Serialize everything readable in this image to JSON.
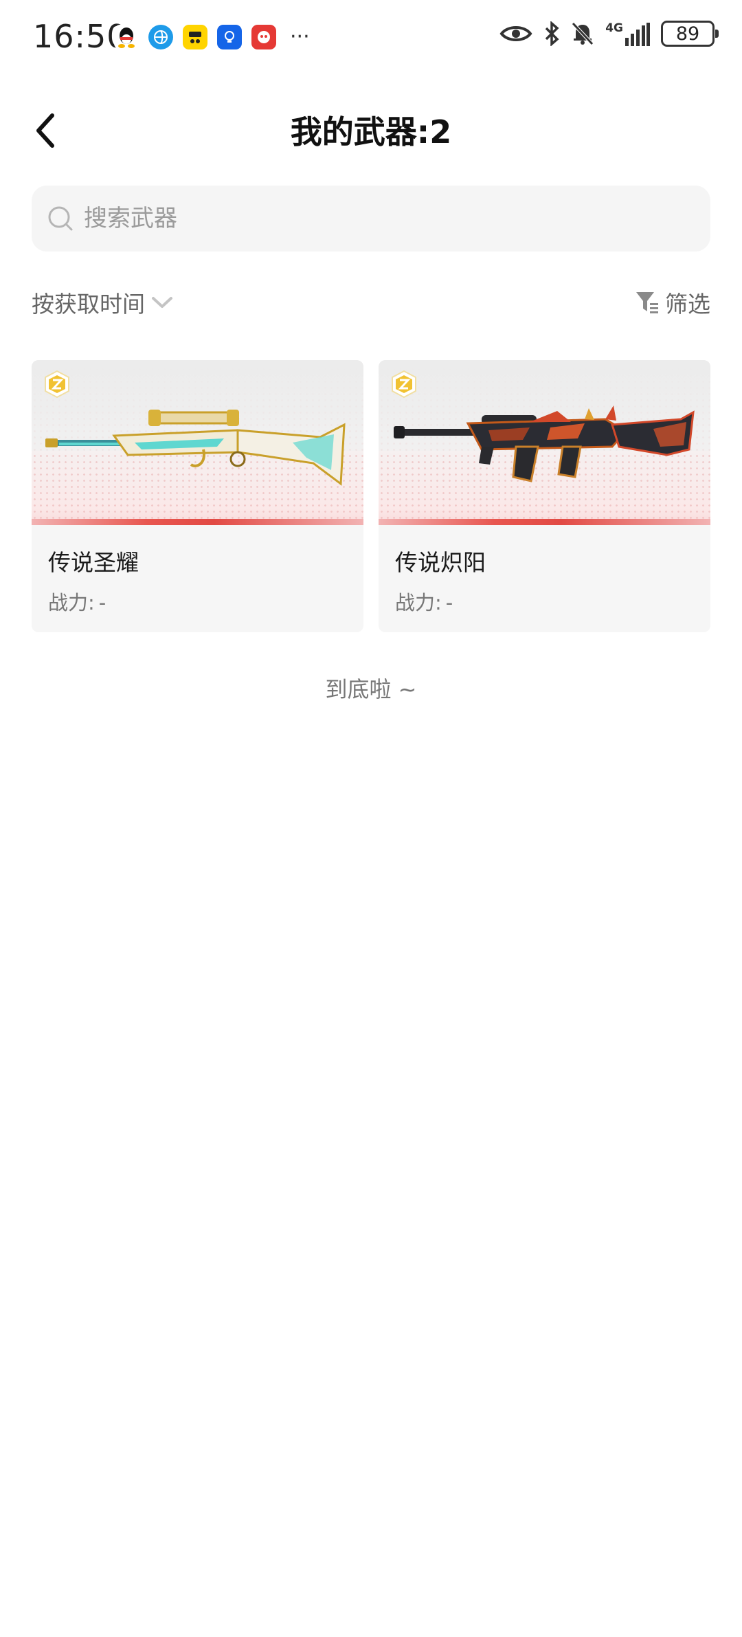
{
  "status_bar": {
    "time": "16:50",
    "more": "···",
    "network": "4G",
    "battery": "89"
  },
  "header": {
    "title": "我的武器:2"
  },
  "search": {
    "placeholder": "搜索武器"
  },
  "sort": {
    "label": "按获取时间"
  },
  "filter": {
    "label": "筛选"
  },
  "weapons": [
    {
      "name": "传说圣耀",
      "power_label": "战力:",
      "power_value": "-"
    },
    {
      "name": "传说炽阳",
      "power_label": "战力:",
      "power_value": "-"
    }
  ],
  "footer": {
    "end_text": "到底啦 ~"
  },
  "colors": {
    "accent_red": "#e24a44",
    "badge_gold": "#f1c232",
    "search_bg": "#f5f5f5"
  },
  "icons": {
    "back": "chevron-left-icon",
    "search": "search-icon",
    "sort": "chevron-down-icon",
    "filter": "filter-icon",
    "rarity": "rarity-badge-icon"
  }
}
